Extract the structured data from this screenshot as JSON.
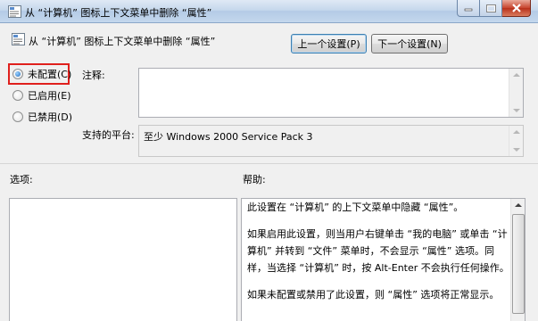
{
  "window": {
    "title": "从 “计算机” 图标上下文菜单中删除 “属性”",
    "buttons": {
      "minimize": "minimize-icon",
      "maximize": "maximize-icon",
      "close": "close-icon"
    }
  },
  "header": {
    "policy_name": "从 “计算机” 图标上下文菜单中删除 “属性”",
    "prev_button": "上一个设置(P)",
    "next_button": "下一个设置(N)"
  },
  "state": {
    "options": [
      {
        "label": "未配置(C)",
        "selected": true
      },
      {
        "label": "已启用(E)",
        "selected": false
      },
      {
        "label": "已禁用(D)",
        "selected": false
      }
    ]
  },
  "comment": {
    "label": "注释:",
    "value": ""
  },
  "platform": {
    "label": "支持的平台:",
    "value": "至少 Windows 2000 Service Pack 3"
  },
  "options_section": {
    "label": "选项:"
  },
  "help_section": {
    "label": "帮助:",
    "paragraphs": [
      "此设置在 “计算机” 的上下文菜单中隐藏 “属性”。",
      "如果启用此设置，则当用户右键单击 “我的电脑” 或单击 “计算机” 并转到 “文件” 菜单时，不会显示 “属性” 选项。同样，当选择 “计算机” 时，按 Alt-Enter 不会执行任何操作。",
      "如果未配置或禁用了此设置，则 “属性” 选项将正常显示。"
    ]
  },
  "colors": {
    "highlight_box": "#e0201d",
    "titlebar": "#c6d8ec"
  }
}
